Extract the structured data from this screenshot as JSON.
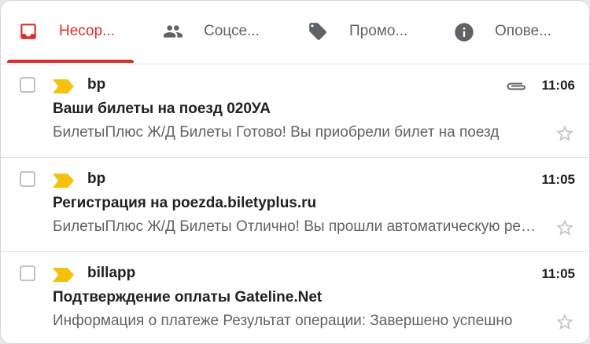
{
  "tabs": [
    {
      "label": "Несор...",
      "icon": "inbox-icon",
      "active": true
    },
    {
      "label": "Соцсе...",
      "icon": "people-icon",
      "active": false
    },
    {
      "label": "Промо...",
      "icon": "tag-icon",
      "active": false
    },
    {
      "label": "Опове...",
      "icon": "info-icon",
      "active": false
    }
  ],
  "colors": {
    "accent": "#d93025",
    "importance": "#f4c20d",
    "text": "#202124",
    "muted": "#5f6368"
  },
  "emails": [
    {
      "sender": "bp",
      "time": "11:06",
      "has_attachment": true,
      "subject": "Ваши билеты на поезд 020УА",
      "snippet": "БилетыПлюс Ж/Д Билеты Готово! Вы приобрели билет на поезд"
    },
    {
      "sender": "bp",
      "time": "11:05",
      "has_attachment": false,
      "subject": "Регистрация на poezda.biletyplus.ru",
      "snippet": "БилетыПлюс Ж/Д Билеты Отлично! Вы прошли автоматическую регистрацию"
    },
    {
      "sender": "billapp",
      "time": "11:05",
      "has_attachment": false,
      "subject": "Подтверждение оплаты Gateline.Net",
      "snippet": "Информация о платеже Результат операции: Завершено успешно"
    }
  ]
}
